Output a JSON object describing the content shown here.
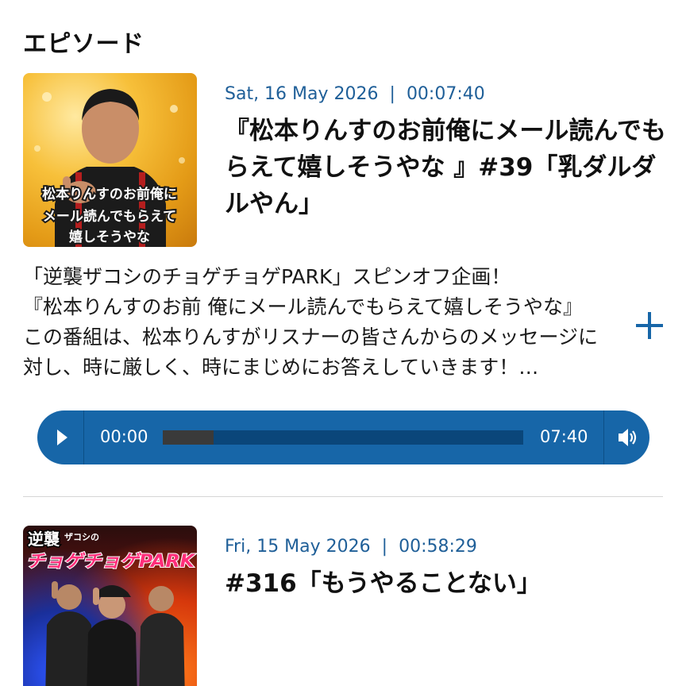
{
  "section": {
    "title": "エピソード"
  },
  "episodes": [
    {
      "date": "Sat, 16 May 2026",
      "separator": "|",
      "duration": "00:07:40",
      "title": "『松本りんすのお前俺にメール読んでもらえて嬉しそうやな 』#39「乳ダルダルやん」",
      "thumbnail_text": [
        "松本りんすのお前俺に",
        "メール読んでもらえて",
        "嬉しそうやな"
      ],
      "description_lines": [
        "「逆襲ザコシのチョゲチョゲPARK」スピンオフ企画！",
        "『松本りんすのお前 俺にメール読んでもらえて嬉しそうやな』",
        "この番組は、松本りんすがリスナーの皆さんからのメッセージに",
        "対し、時に厳しく、時にまじめにお答えしていきます！…"
      ],
      "expand_icon": "plus-icon",
      "player": {
        "play_icon": "play-icon",
        "current_time": "00:00",
        "total_time": "07:40",
        "buffered_fraction": 0.14,
        "played_fraction": 0,
        "volume_icon": "volume-icon"
      }
    },
    {
      "date": "Fri, 15 May 2026",
      "separator": "|",
      "duration": "00:58:29",
      "title": "#316「もうやることない」",
      "thumbnail_text": [
        "逆襲",
        "ザコシの",
        "チョゲチョゲPARK"
      ]
    }
  ],
  "colors": {
    "accent": "#1f5f98",
    "player_bg": "#1766a8",
    "player_track": "#0a467a",
    "player_buffer": "#3a3a3a"
  }
}
